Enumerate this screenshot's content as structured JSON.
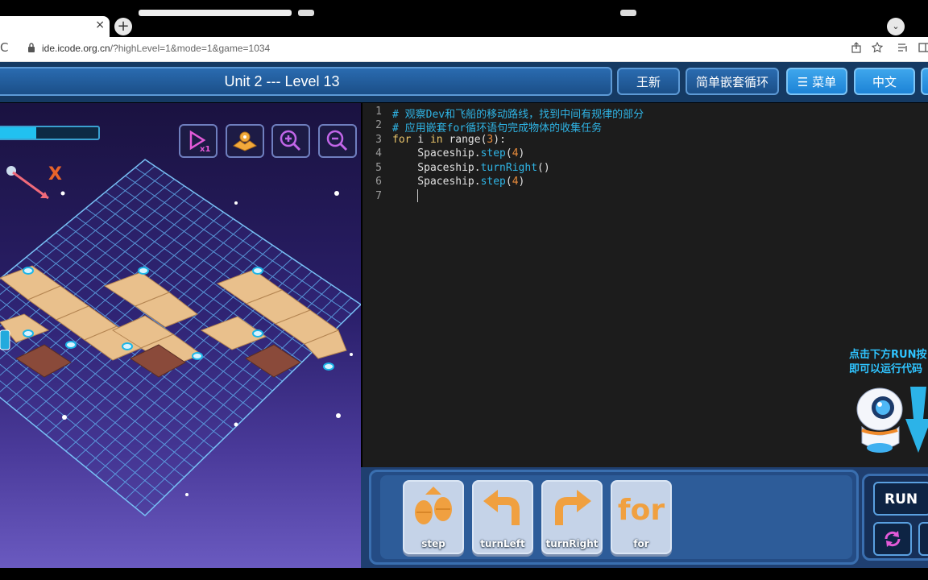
{
  "browser": {
    "tab_close": "×",
    "new_tab": "+",
    "tab_menu": "⌄",
    "reload_icon": "C",
    "url_host": "ide.icode.org.cn",
    "url_rest": "/?highLevel=1&mode=1&game=1034"
  },
  "header": {
    "title": "Unit 2 --- Level 13",
    "user": "王新",
    "lesson": "简单嵌套循环",
    "menu_icon": "☰",
    "menu": "菜单",
    "language": "中文"
  },
  "game": {
    "progress": 0.38,
    "x_marker": "X"
  },
  "editor": {
    "line_numbers": [
      "1",
      "2",
      "3",
      "4",
      "5",
      "6",
      "7"
    ],
    "lines": {
      "l1": "# 观察Dev和飞船的移动路线，找到中间有规律的部分",
      "l2": "# 应用嵌套for循环语句完成物体的收集任务",
      "l3_kw": "for",
      "l3_mid": " i ",
      "l3_in": "in",
      "l3_range": " range(",
      "l3_num": "3",
      "l3_end": "):",
      "l4_obj": "    Spaceship.",
      "l4_fn": "step",
      "l4_open": "(",
      "l4_num": "4",
      "l4_close": ")",
      "l5_obj": "    Spaceship.",
      "l5_fn": "turnRight",
      "l5_args": "()",
      "l6_obj": "    Spaceship.",
      "l6_fn": "step",
      "l6_open": "(",
      "l6_num": "4",
      "l6_close": ")"
    }
  },
  "hint": {
    "line1": "点击下方RUN按",
    "line2": "即可以运行代码"
  },
  "blocks": {
    "step": "step",
    "turnLeft": "turnLeft",
    "turnRight": "turnRight",
    "for": "for"
  },
  "run": {
    "label": "RUN"
  },
  "colors": {
    "code_comment": "#2fb5e6",
    "code_keyword": "#e9c46a",
    "code_number": "#e88b3c",
    "header_bg": "#153a63",
    "block_orange": "#f0a040"
  }
}
